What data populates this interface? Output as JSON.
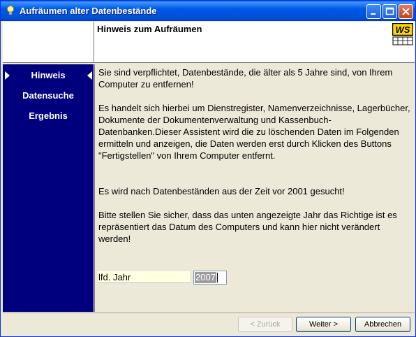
{
  "window": {
    "title": "Aufräumen alter Datenbestände"
  },
  "header": {
    "title": "Hinweis zum Aufräumen",
    "logo_text": "WS"
  },
  "sidebar": {
    "items": [
      {
        "label": "Hinweis"
      },
      {
        "label": "Datensuche"
      },
      {
        "label": "Ergebnis"
      }
    ]
  },
  "content": {
    "p1": "Sie sind verpflichtet, Datenbestände, die älter als 5 Jahre sind, von Ihrem Computer zu entfernen!",
    "p2": "Es handelt sich hierbei um Dienstregister, Namenverzeichnisse, Lagerbücher, Dokumente der Dokumentenverwaltung und Kassenbuch-Datenbanken.Dieser Assistent wird die zu löschenden Daten im Folgenden ermitteln und anzeigen, die Daten werden erst durch Klicken des Buttons \"Fertigstellen\" von Ihrem Computer entfernt.",
    "p3": "Es wird nach Datenbeständen aus der Zeit vor 2001 gesucht!",
    "p4": "Bitte stellen Sie sicher, dass das unten angezeigte Jahr das Richtige ist es repräsentiert das Datum des Computers und kann hier nicht verändert werden!",
    "year_label": "lfd. Jahr",
    "year_value": "2007"
  },
  "buttons": {
    "back": "< Zurück",
    "next": "Weiter >",
    "cancel": "Abbrechen"
  },
  "icons": {
    "title": "lightbulb-icon",
    "logo": "ws-logo"
  }
}
